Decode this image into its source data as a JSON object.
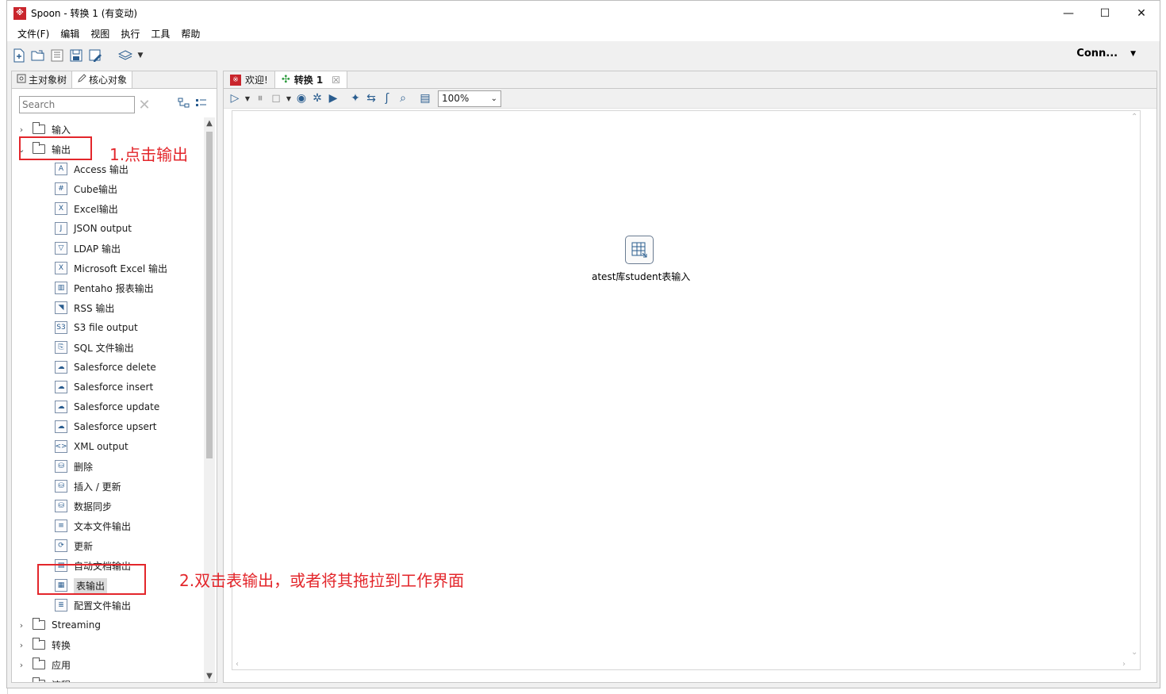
{
  "window": {
    "title": "Spoon - 转换 1 (有变动)",
    "logo_char": "※",
    "controls": {
      "minimize": "—",
      "maximize": "☐",
      "close": "✕"
    }
  },
  "menu": [
    "文件(F)",
    "编辑",
    "视图",
    "执行",
    "工具",
    "帮助"
  ],
  "toolbar": {
    "conn_label": "Conn...",
    "icons": [
      "new-file-icon",
      "open-file-icon",
      "explore-repo-icon",
      "save-icon",
      "save-as-icon",
      "perspective-icon"
    ]
  },
  "left_panel": {
    "tabs": [
      "主对象树",
      "核心对象"
    ],
    "search_placeholder": "Search",
    "tree": {
      "folders_top": [
        {
          "label": "输入",
          "expanded": false
        },
        {
          "label": "输出",
          "expanded": true
        }
      ],
      "output_items": [
        {
          "label": "Access 输出",
          "icon_glyph": "A"
        },
        {
          "label": "Cube输出",
          "icon_glyph": "#"
        },
        {
          "label": "Excel输出",
          "icon_glyph": "X"
        },
        {
          "label": "JSON output",
          "icon_glyph": "J"
        },
        {
          "label": "LDAP 输出",
          "icon_glyph": "▽"
        },
        {
          "label": "Microsoft Excel 输出",
          "icon_glyph": "X"
        },
        {
          "label": "Pentaho 报表输出",
          "icon_glyph": "▥"
        },
        {
          "label": "RSS 输出",
          "icon_glyph": "◥"
        },
        {
          "label": "S3 file output",
          "icon_glyph": "S3"
        },
        {
          "label": "SQL 文件输出",
          "icon_glyph": "⎘"
        },
        {
          "label": "Salesforce delete",
          "icon_glyph": "☁"
        },
        {
          "label": "Salesforce insert",
          "icon_glyph": "☁"
        },
        {
          "label": "Salesforce update",
          "icon_glyph": "☁"
        },
        {
          "label": "Salesforce upsert",
          "icon_glyph": "☁"
        },
        {
          "label": "XML output",
          "icon_glyph": "<>"
        },
        {
          "label": "删除",
          "icon_glyph": "⛁"
        },
        {
          "label": "插入 / 更新",
          "icon_glyph": "⛁"
        },
        {
          "label": "数据同步",
          "icon_glyph": "⛁"
        },
        {
          "label": "文本文件输出",
          "icon_glyph": "≡"
        },
        {
          "label": "更新",
          "icon_glyph": "⟳"
        },
        {
          "label": "自动文档输出",
          "icon_glyph": "▤"
        },
        {
          "label": "表输出",
          "icon_glyph": "▦",
          "selected": true
        },
        {
          "label": "配置文件输出",
          "icon_glyph": "≣"
        }
      ],
      "folders_bottom": [
        {
          "label": "Streaming"
        },
        {
          "label": "转换"
        },
        {
          "label": "应用"
        },
        {
          "label": "流程"
        }
      ]
    }
  },
  "annotations": {
    "step1": "1.点击输出",
    "step2": "2.双击表输出，或者将其拖拉到工作界面"
  },
  "editor": {
    "tabs": [
      {
        "label": "欢迎!",
        "active": false
      },
      {
        "label": "转换 1",
        "active": true,
        "close": "☒"
      }
    ],
    "zoom": "100%",
    "canvas_step_label": "atest库student表输入"
  },
  "colors": {
    "annotation": "#e3262b",
    "logo": "#c9252c",
    "icon_blue": "#2a5d8f",
    "trans_green": "#2e9b3e"
  }
}
